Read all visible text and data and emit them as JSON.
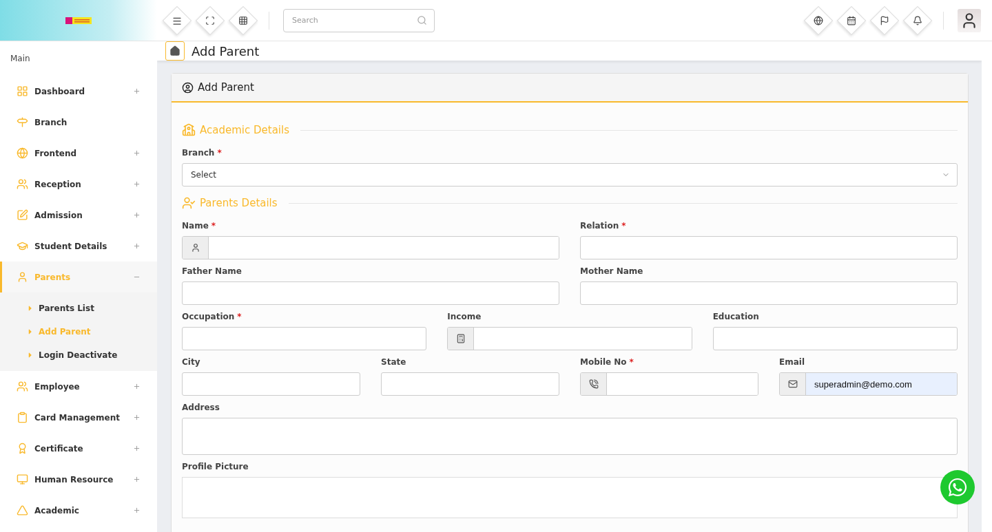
{
  "header": {
    "search": {
      "placeholder": "Search"
    }
  },
  "sidebar": {
    "heading": "Main",
    "items": [
      {
        "label": "Dashboard",
        "has_submenu": true,
        "expanded": false,
        "selected": false
      },
      {
        "label": "Branch",
        "has_submenu": false,
        "selected": false
      },
      {
        "label": "Frontend",
        "has_submenu": true,
        "expanded": false,
        "selected": false
      },
      {
        "label": "Reception",
        "has_submenu": true,
        "expanded": false,
        "selected": false
      },
      {
        "label": "Admission",
        "has_submenu": true,
        "expanded": false,
        "selected": false
      },
      {
        "label": "Student Details",
        "has_submenu": true,
        "expanded": false,
        "selected": false
      },
      {
        "label": "Parents",
        "has_submenu": true,
        "expanded": true,
        "selected": true,
        "children": [
          {
            "label": "Parents List",
            "selected": false
          },
          {
            "label": "Add Parent",
            "selected": true
          },
          {
            "label": "Login Deactivate",
            "selected": false
          }
        ]
      },
      {
        "label": "Employee",
        "has_submenu": true,
        "expanded": false,
        "selected": false
      },
      {
        "label": "Card Management",
        "has_submenu": true,
        "expanded": false,
        "selected": false
      },
      {
        "label": "Certificate",
        "has_submenu": true,
        "expanded": false,
        "selected": false
      },
      {
        "label": "Human Resource",
        "has_submenu": true,
        "expanded": false,
        "selected": false
      },
      {
        "label": "Academic",
        "has_submenu": true,
        "expanded": false,
        "selected": false
      }
    ]
  },
  "page_title": "Add Parent",
  "card": {
    "title": "Add Parent",
    "sections": [
      {
        "title": "Academic Details",
        "field_groups": [
          {
            "fields": [
              {
                "label": "Branch",
                "mark": "*",
                "kind": "select",
                "value": "Select"
              }
            ]
          }
        ]
      },
      {
        "title": "Parents Details",
        "field_groups": [
          {
            "fields": [
              {
                "label": "Name",
                "mark": "*",
                "kind": "addon",
                "autofilled": false
              },
              {
                "label": "Relation",
                "mark": "*",
                "kind": "text",
                "autofilled": false
              }
            ]
          },
          {
            "fields": [
              {
                "label": "Father Name",
                "kind": "text",
                "autofilled": false
              },
              {
                "label": "Mother Name",
                "kind": "text",
                "autofilled": false
              }
            ]
          },
          {
            "fields": [
              {
                "label": "Occupation",
                "mark": "*",
                "kind": "text",
                "autofilled": false
              },
              {
                "label": "Income",
                "kind": "addon",
                "autofilled": false
              },
              {
                "label": "Education",
                "kind": "text",
                "autofilled": false
              }
            ]
          },
          {
            "fields": [
              {
                "label": "City",
                "kind": "text",
                "autofilled": false
              },
              {
                "label": "State",
                "kind": "text",
                "autofilled": false
              },
              {
                "label": "Mobile No",
                "mark": "*",
                "kind": "addon",
                "autofilled": false
              },
              {
                "label": "Email",
                "kind": "addon",
                "value": "superadmin@demo.com",
                "autofilled": true
              }
            ]
          },
          {
            "fields": [
              {
                "label": "Address",
                "kind": "textarea"
              }
            ]
          },
          {
            "fields": [
              {
                "label": "Profile Picture",
                "kind": "file"
              }
            ]
          }
        ]
      }
    ]
  }
}
